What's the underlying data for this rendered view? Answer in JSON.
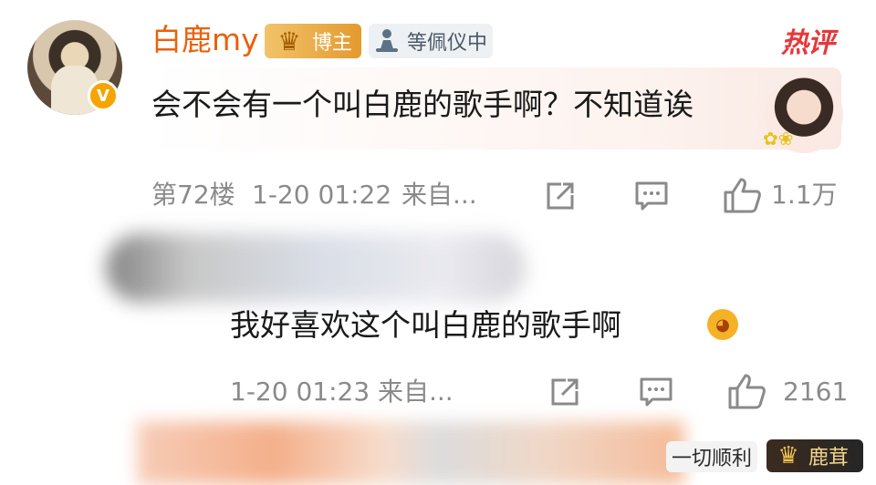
{
  "comment1": {
    "username": "白鹿my",
    "verified_badge": "V",
    "author_badge": {
      "label": "博主",
      "icon": "crown-icon"
    },
    "fan_badge": {
      "label": "等佩仪中",
      "icon": "meditation-figure-icon"
    },
    "hot_tag": "热评",
    "text": "会不会有一个叫白鹿的歌手啊？不知道诶",
    "floor": "第72楼",
    "time": "1-20 01:22",
    "source": "来自...",
    "like_count": "1.1万"
  },
  "comment2": {
    "text": "我好喜欢这个叫白鹿的歌手啊",
    "time": "1-20 01:23",
    "source": "来自...",
    "like_count": "2161"
  },
  "comment3": {
    "tag": "一切顺利",
    "badge": {
      "label": "鹿茸",
      "icon": "crown-icon"
    }
  },
  "colors": {
    "username": "#e8620c",
    "hot_tag": "#e4393c",
    "meta_text": "#8a8a8a"
  }
}
